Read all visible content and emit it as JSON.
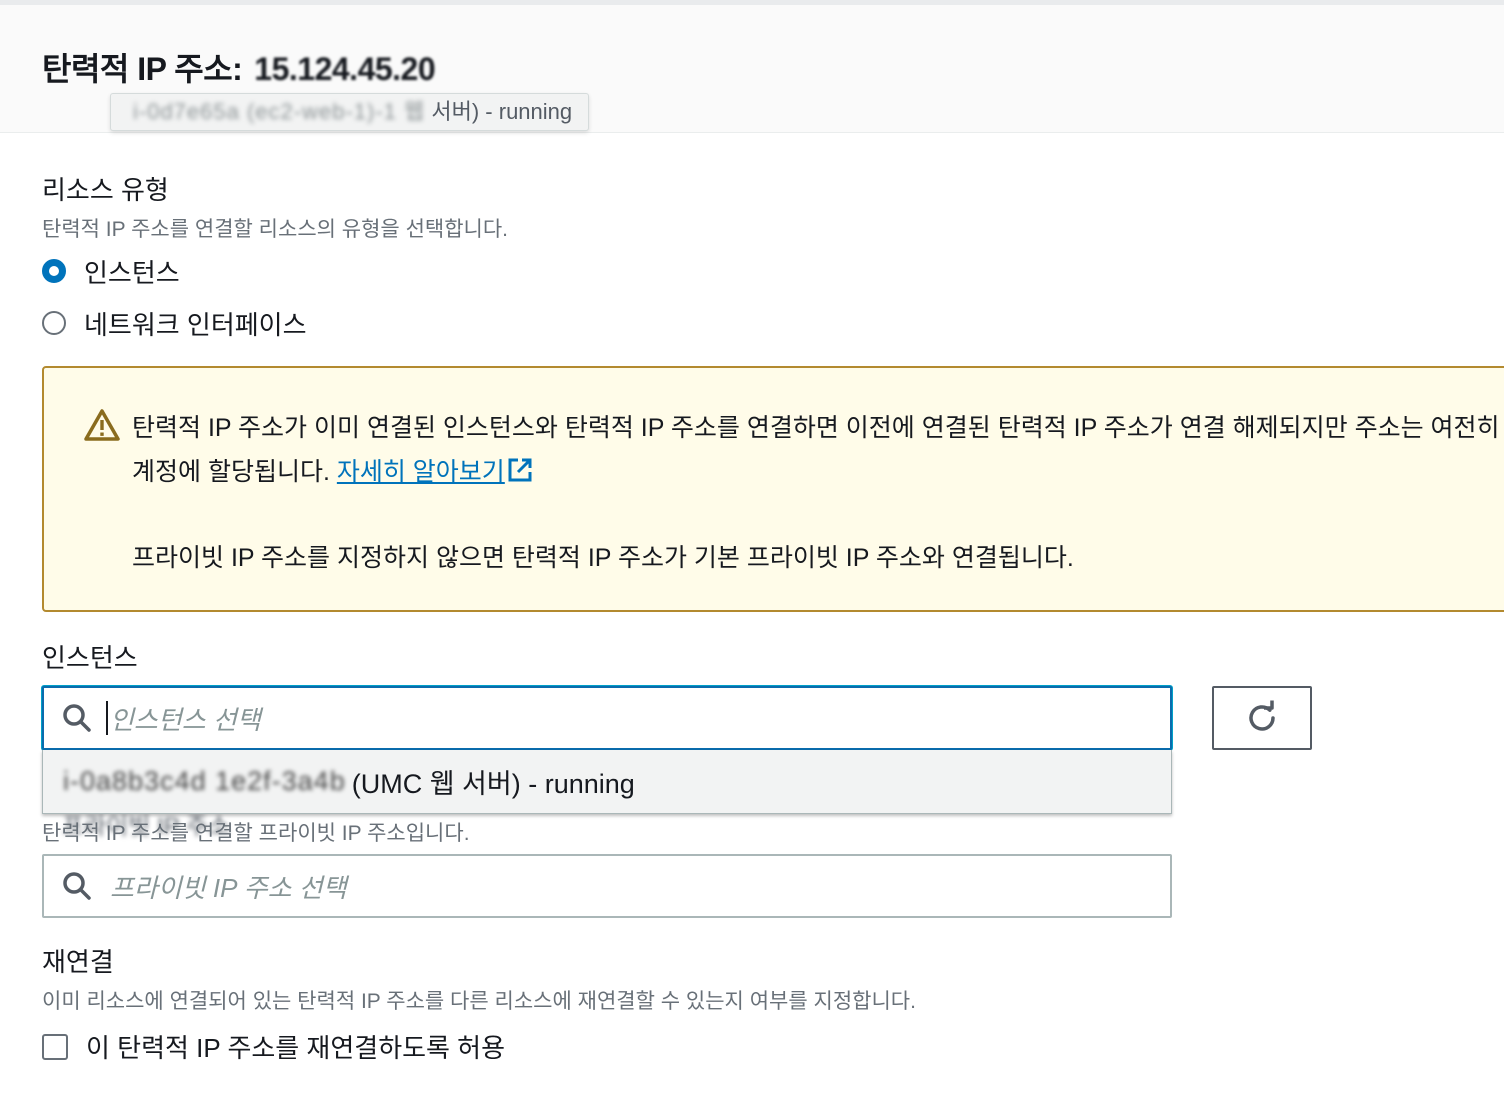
{
  "header": {
    "title_prefix": "탄력적 IP 주소:",
    "title_ip": "15.124.45.20",
    "tooltip_blurred": "i-0d7e65a (ec2-web-1)-1 웹",
    "tooltip_suffix": "서버) - running"
  },
  "resource_type": {
    "label": "리소스 유형",
    "description": "탄력적 IP 주소를 연결할 리소스의 유형을 선택합니다.",
    "options": [
      {
        "label": "인스턴스",
        "checked": true
      },
      {
        "label": "네트워크 인터페이스",
        "checked": false
      }
    ]
  },
  "alert": {
    "text": "탄력적 IP 주소가 이미 연결된 인스턴스와 탄력적 IP 주소를 연결하면 이전에 연결된 탄력적 IP 주소가 연결 해제되지만 주소는 여전히 계정에 할당됩니다.",
    "link_text": "자세히 알아보기",
    "text2": "프라이빗 IP 주소를 지정하지 않으면 탄력적 IP 주소가 기본 프라이빗 IP 주소와 연결됩니다."
  },
  "instance": {
    "label": "인스턴스",
    "placeholder": "인스턴스 선택",
    "dropdown_blurred": "i-0a8b3c4d 1e2f-3a4b",
    "dropdown_text": "(UMC 웹 서버) - running",
    "ghost_text": "프라이빗 IP 주소"
  },
  "private_ip": {
    "description": "탄력적 IP 주소를 연결할 프라이빗 IP 주소입니다.",
    "placeholder": "프라이빗 IP 주소 선택"
  },
  "reassociation": {
    "label": "재연결",
    "description": "이미 리소스에 연결되어 있는 탄력적 IP 주소를 다른 리소스에 재연결할 수 있는지 여부를 지정합니다.",
    "checkbox_label": "이 탄력적 IP 주소를 재연결하도록 허용",
    "checked": false
  },
  "colors": {
    "accent": "#0073bb",
    "warning_border": "#b38a2f",
    "warning_bg": "#fffce9"
  }
}
